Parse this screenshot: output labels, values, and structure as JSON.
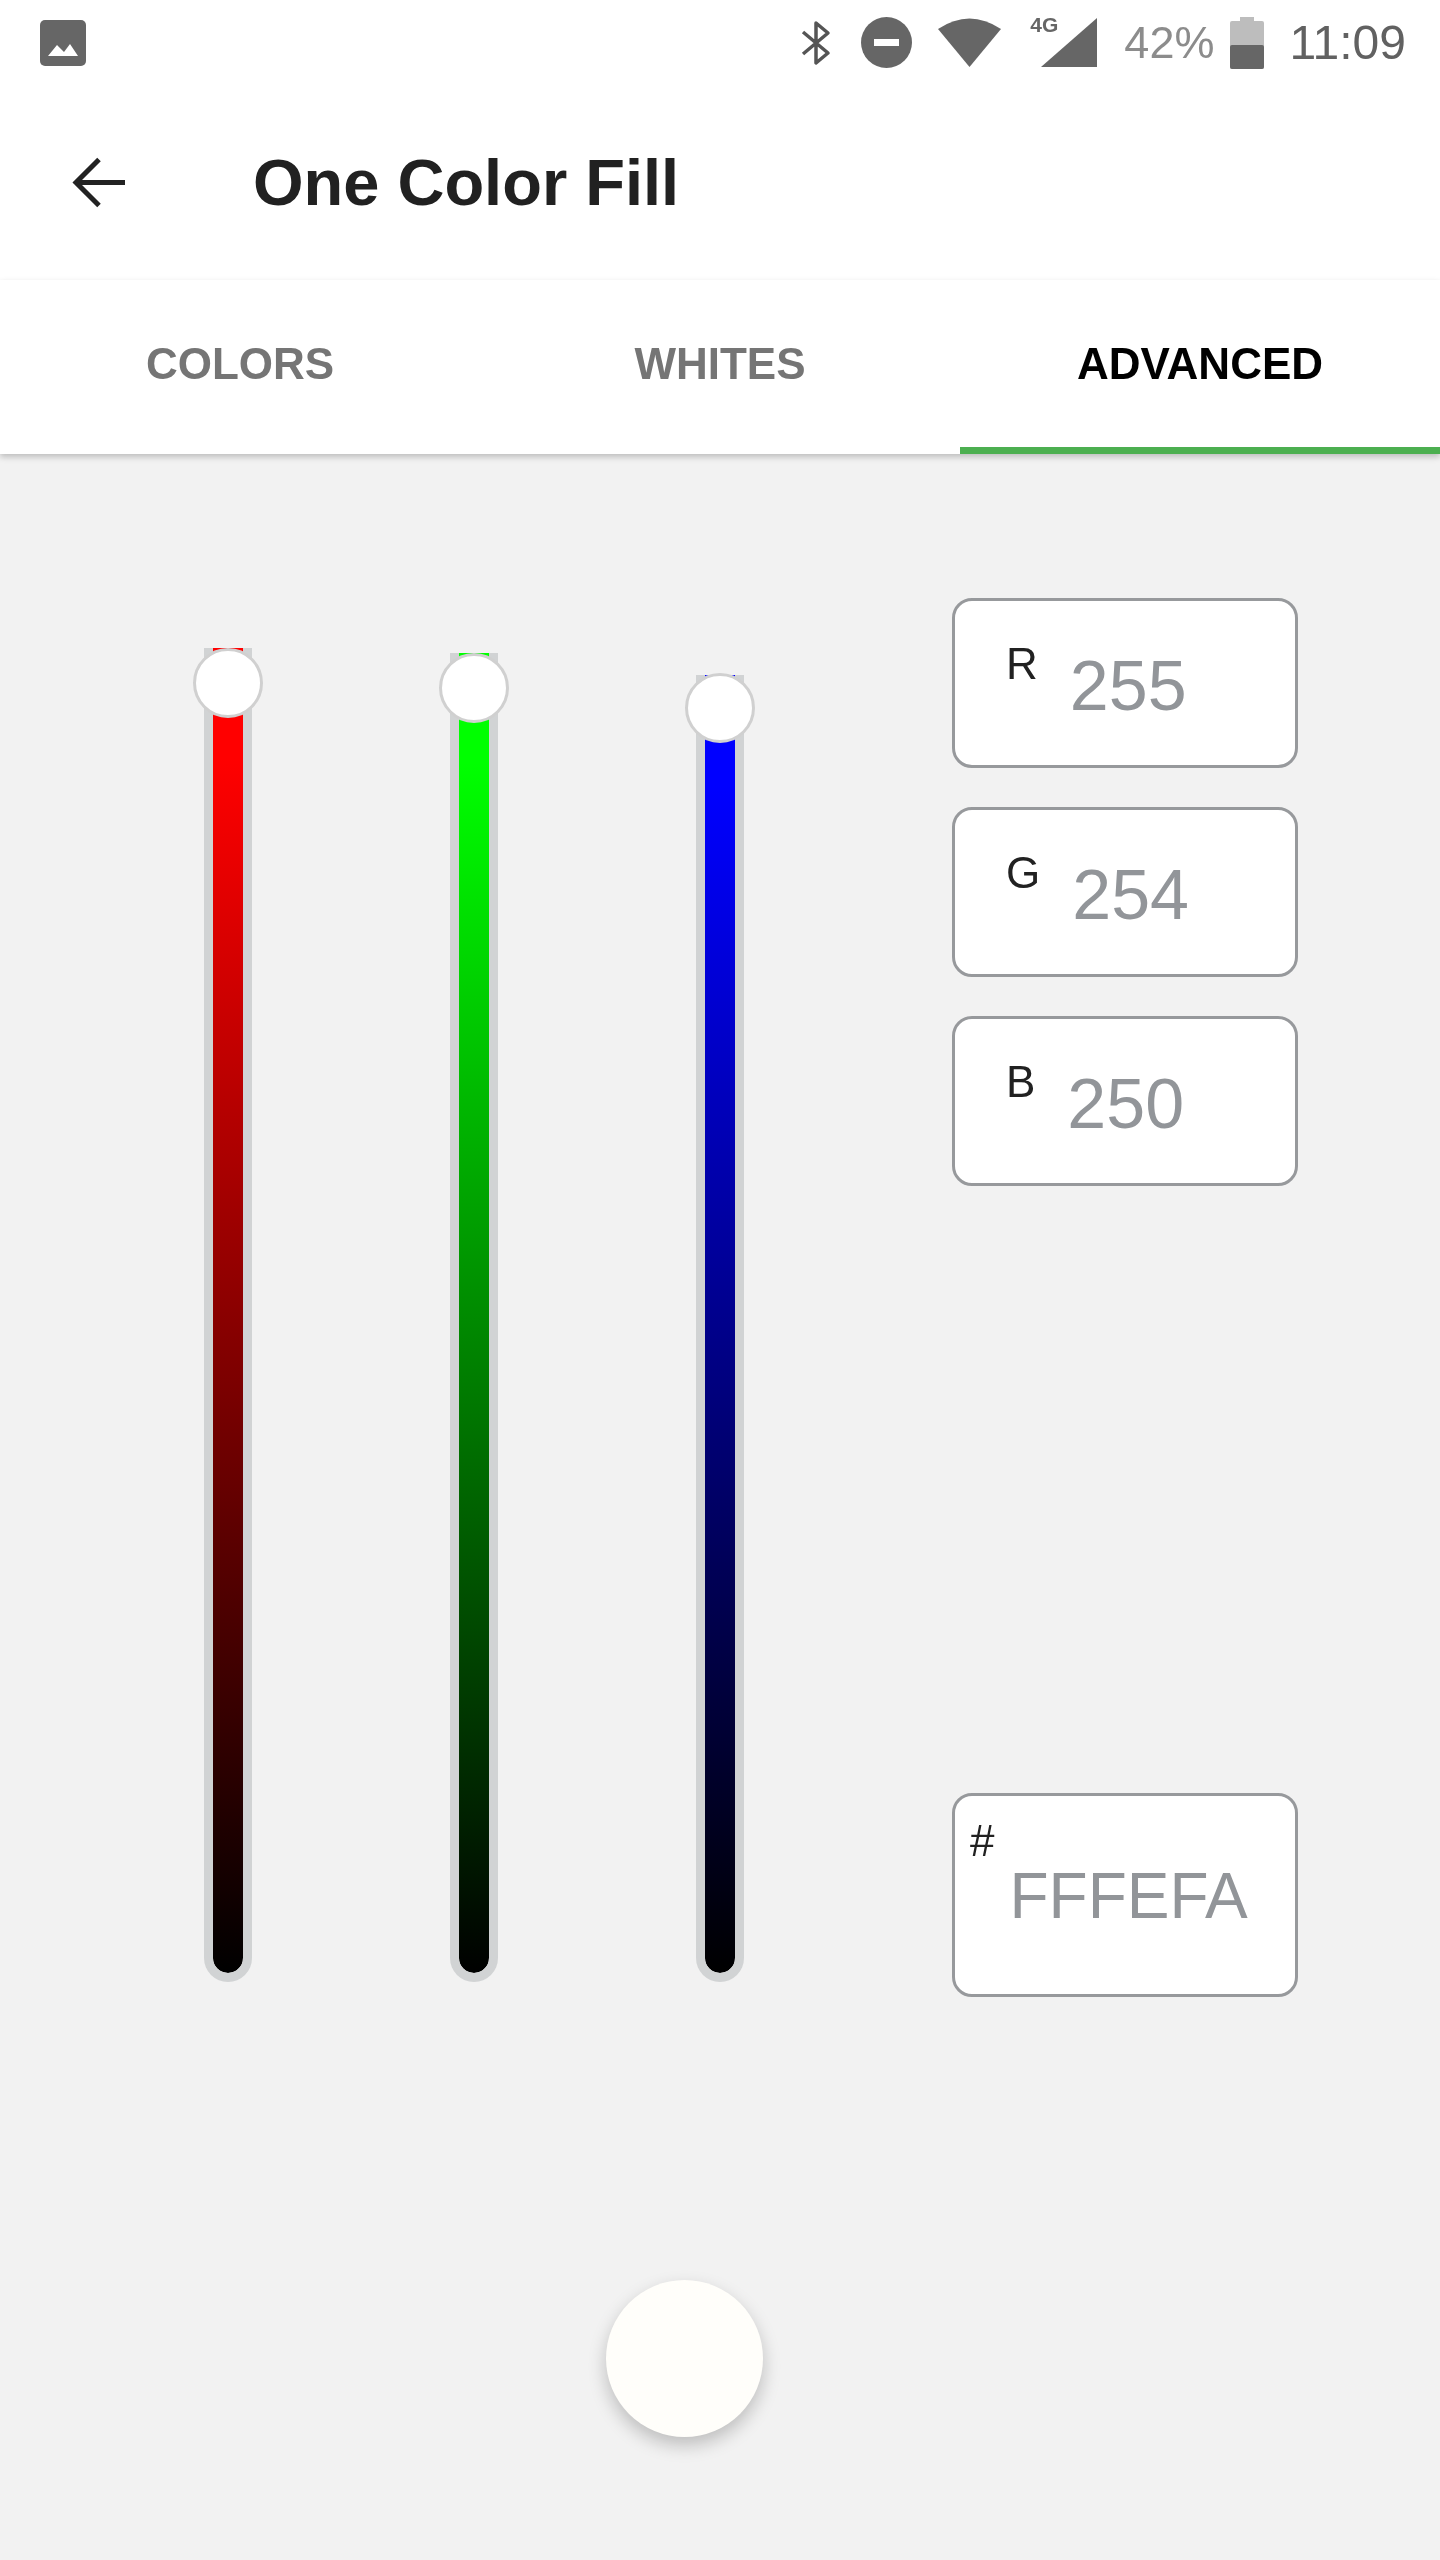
{
  "status_bar": {
    "network_type": "4G",
    "battery": "42%",
    "time": "11:09"
  },
  "app_bar": {
    "title": "One Color Fill"
  },
  "tabs": [
    {
      "label": "COLORS",
      "selected": false
    },
    {
      "label": "WHITES",
      "selected": false
    },
    {
      "label": "ADVANCED",
      "selected": true
    }
  ],
  "sliders": [
    {
      "color": "#ff0000",
      "level": 1
    },
    {
      "color": "#00ff00",
      "level": 0.996
    },
    {
      "color": "#0000ff",
      "level": 0.98
    }
  ],
  "fields": [
    {
      "label": "R",
      "value": "255"
    },
    {
      "label": "G",
      "value": "254"
    },
    {
      "label": "B",
      "value": "250"
    }
  ],
  "hex_field": {
    "label": "#",
    "value": "FFFEFA"
  },
  "preview": {
    "color": "#fffefa"
  }
}
